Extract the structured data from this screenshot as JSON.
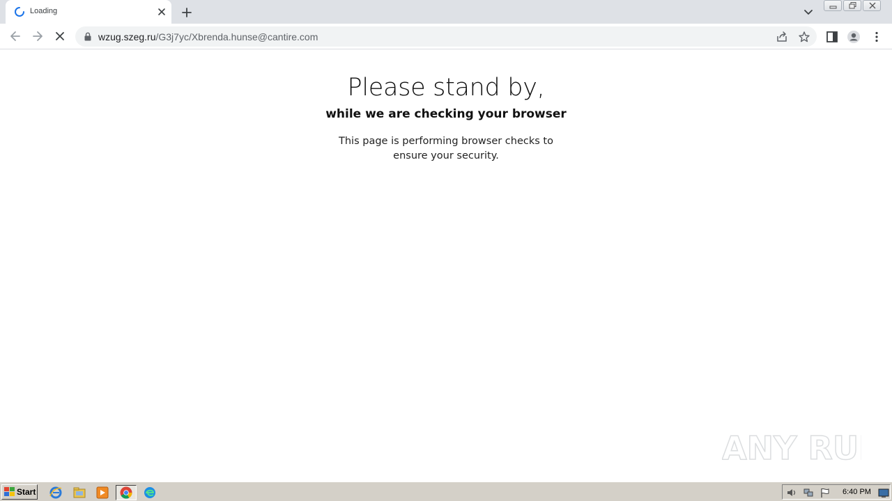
{
  "browser": {
    "tab": {
      "title": "Loading"
    },
    "address": {
      "host": "wzug.szeg.ru",
      "path": "/G3j7yc/Xbrenda.hunse@cantire.com"
    }
  },
  "page": {
    "headline": "Please stand by,",
    "subhead": "while we are checking your browser",
    "body": "This page is performing browser checks to ensure your security."
  },
  "watermark": {
    "text": "ANY RUN"
  },
  "taskbar": {
    "start_label": "Start",
    "clock": "6:40 PM"
  },
  "colors": {
    "accent": "#1a73e8",
    "tabstrip": "#dee1e6",
    "taskbar": "#d4d0c8"
  }
}
